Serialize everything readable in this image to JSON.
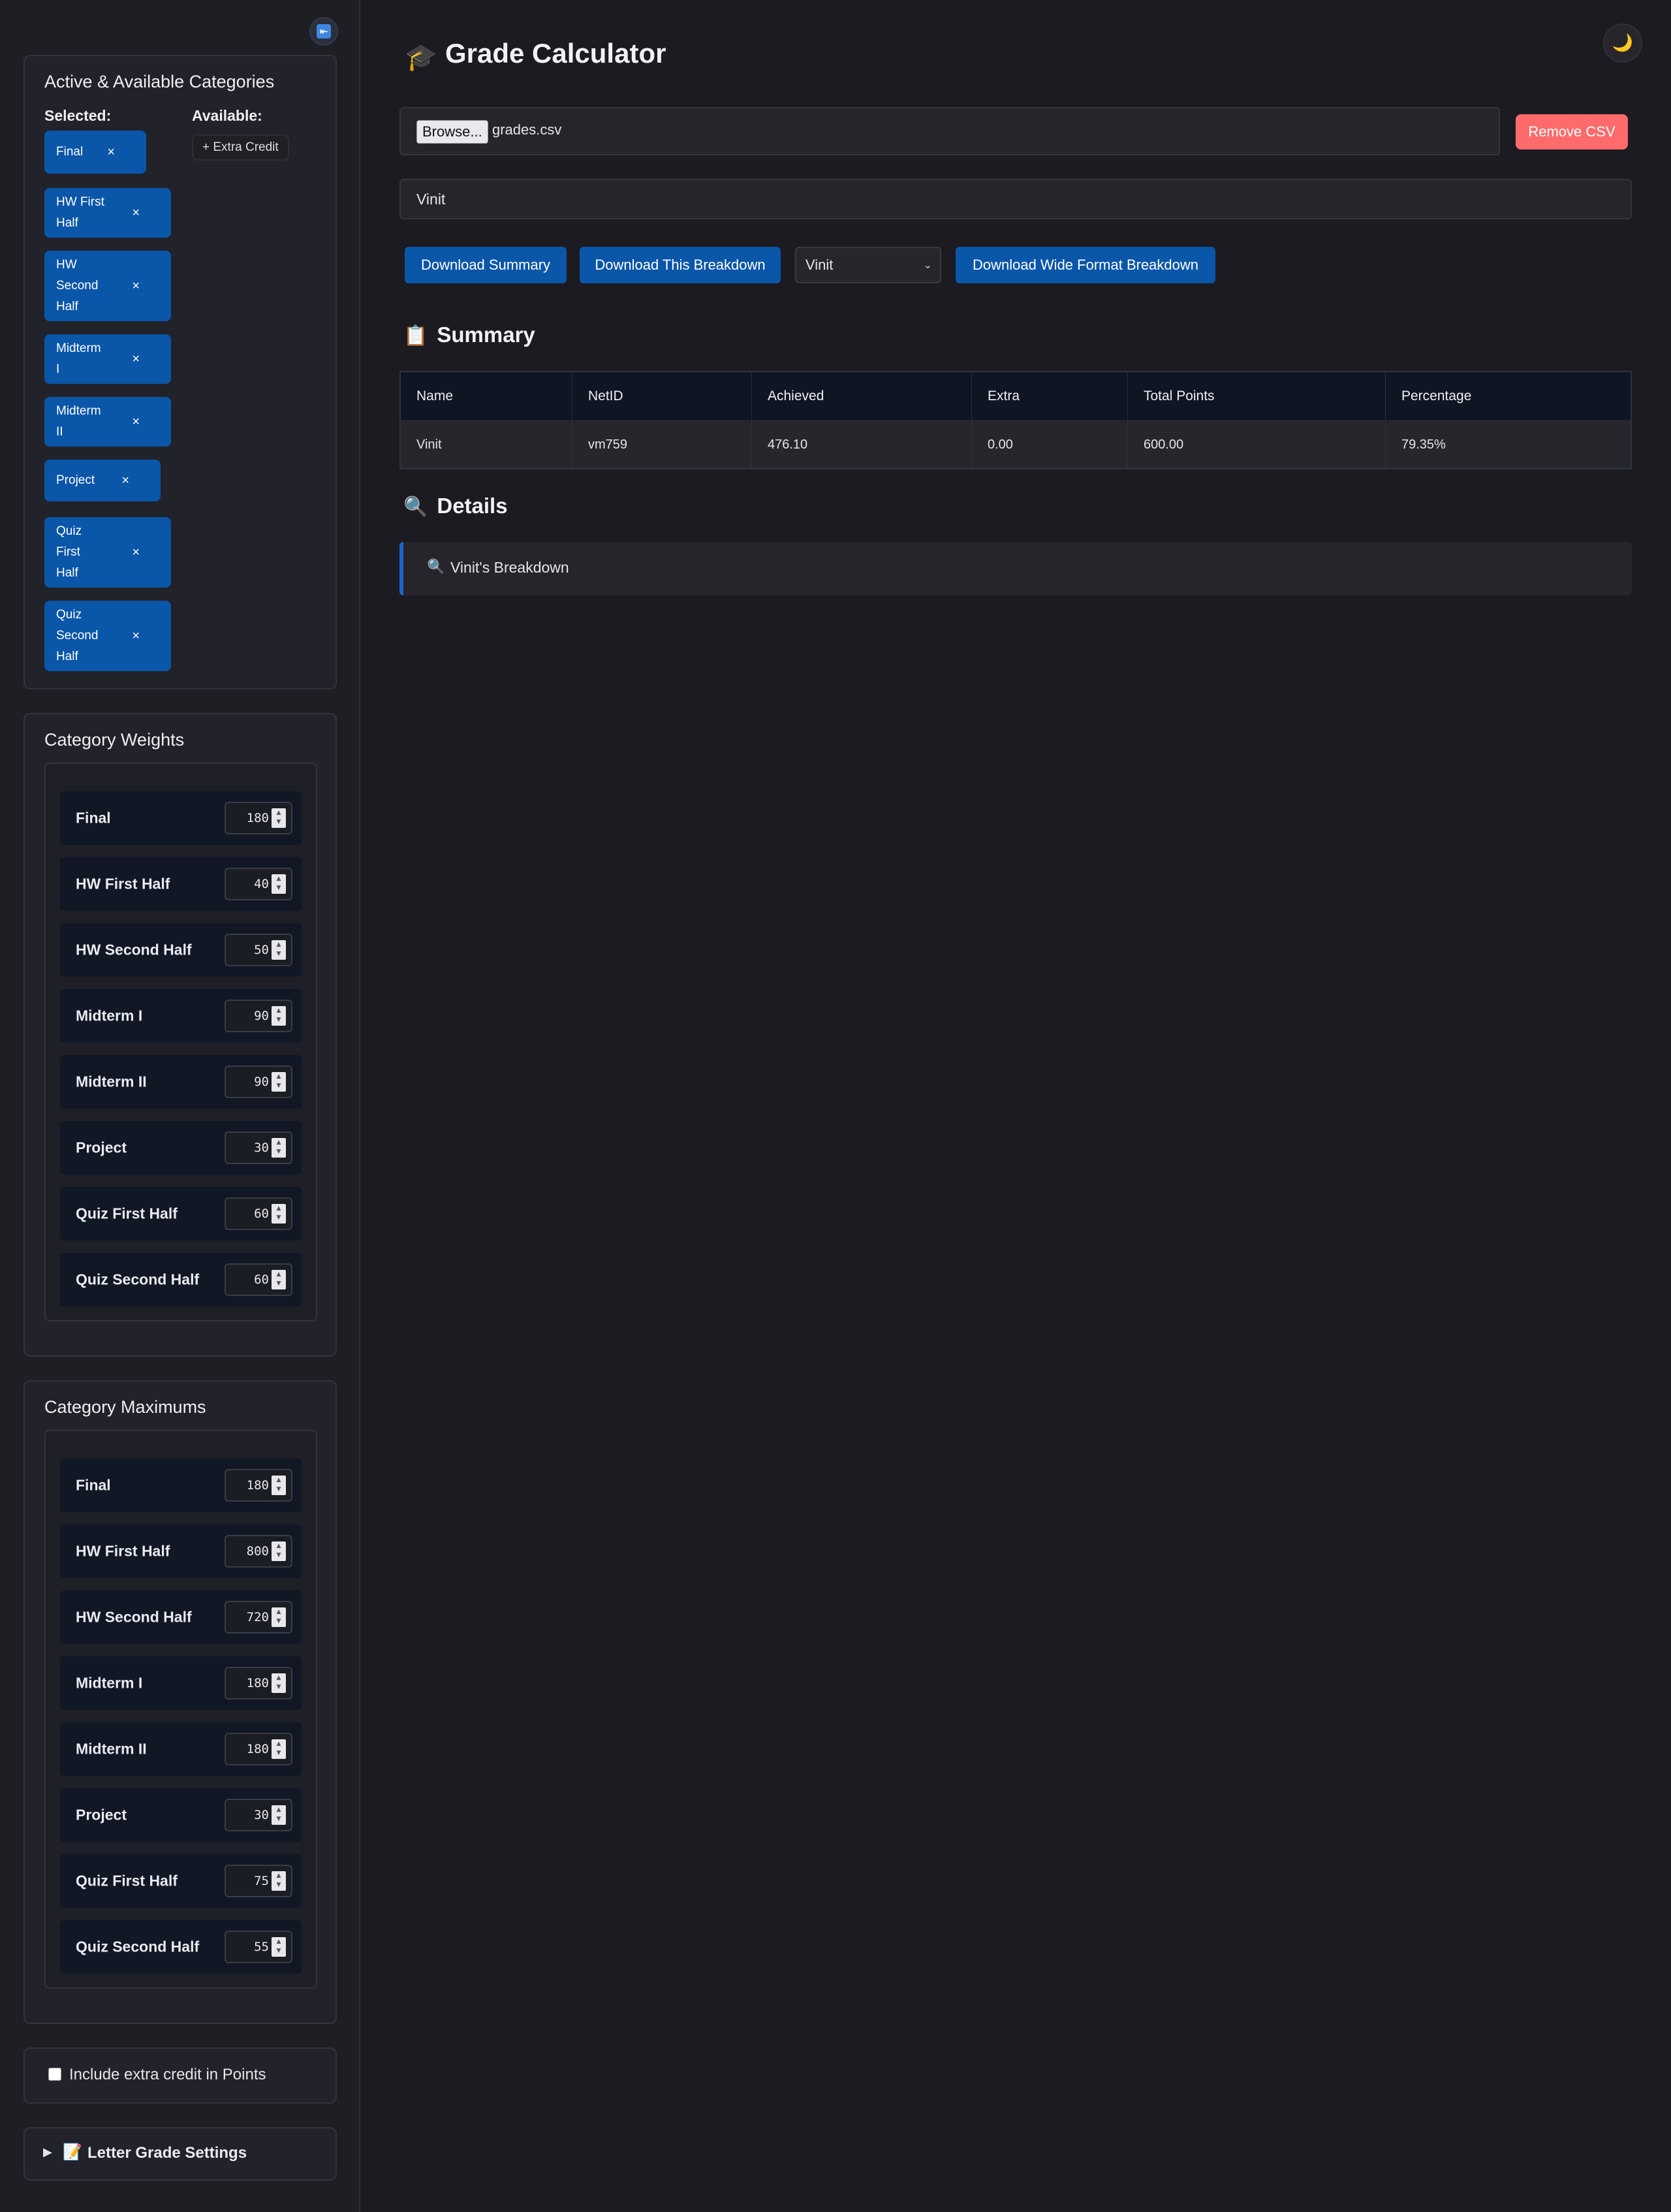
{
  "sidebar": {
    "categories": {
      "title": "Active & Available Categories",
      "selected_label": "Selected:",
      "available_label": "Available:",
      "remove_glyph": "×",
      "selected": [
        {
          "lines": [
            "Final"
          ]
        },
        {
          "lines": [
            "HW First",
            "Half"
          ]
        },
        {
          "lines": [
            "HW",
            "Second",
            "Half"
          ]
        },
        {
          "lines": [
            "Midterm",
            "I"
          ]
        },
        {
          "lines": [
            "Midterm",
            "II"
          ]
        },
        {
          "lines": [
            "Project"
          ]
        },
        {
          "lines": [
            "Quiz",
            "First",
            "Half"
          ]
        },
        {
          "lines": [
            "Quiz",
            "Second",
            "Half"
          ]
        }
      ],
      "available": [
        "+ Extra Credit"
      ]
    },
    "weights": {
      "title": "Category Weights",
      "rows": [
        {
          "label": "Final",
          "value": "180"
        },
        {
          "label": "HW First Half",
          "value": "40"
        },
        {
          "label": "HW Second Half",
          "value": "50"
        },
        {
          "label": "Midterm I",
          "value": "90"
        },
        {
          "label": "Midterm II",
          "value": "90"
        },
        {
          "label": "Project",
          "value": "30"
        },
        {
          "label": "Quiz First Half",
          "value": "60"
        },
        {
          "label": "Quiz Second Half",
          "value": "60"
        }
      ]
    },
    "maximums": {
      "title": "Category Maximums",
      "rows": [
        {
          "label": "Final",
          "value": "180"
        },
        {
          "label": "HW First Half",
          "value": "800"
        },
        {
          "label": "HW Second Half",
          "value": "720"
        },
        {
          "label": "Midterm I",
          "value": "180"
        },
        {
          "label": "Midterm II",
          "value": "180"
        },
        {
          "label": "Project",
          "value": "30"
        },
        {
          "label": "Quiz First Half",
          "value": "75"
        },
        {
          "label": "Quiz Second Half",
          "value": "55"
        }
      ]
    },
    "extra_credit_checkbox": {
      "label": "Include extra credit in Points",
      "checked": false
    },
    "letter_grade": {
      "label": "Letter Grade Settings",
      "icon": "memo-icon"
    }
  },
  "header": {
    "title": "Grade Calculator",
    "icon": "graduation-cap-icon",
    "theme_icon": "moon-icon"
  },
  "file": {
    "browse_label": "Browse...",
    "file_name": "grades.csv",
    "remove_label": "Remove CSV"
  },
  "student_input": {
    "value": "Vinit"
  },
  "actions": {
    "download_summary": "Download Summary",
    "download_breakdown": "Download This Breakdown",
    "student_select": "Vinit",
    "download_wide": "Download Wide Format Breakdown"
  },
  "summary": {
    "title": "Summary",
    "icon": "clipboard-icon",
    "columns": [
      "Name",
      "NetID",
      "Achieved",
      "Extra",
      "Total Points",
      "Percentage"
    ],
    "rows": [
      [
        "Vinit",
        "vm759",
        "476.10",
        "0.00",
        "600.00",
        "79.35%"
      ]
    ]
  },
  "details": {
    "title": "Details",
    "icon": "magnifier-icon",
    "breakdown_label": "Vinit's Breakdown"
  },
  "colors": {
    "accent": "#0a56a8",
    "danger": "#ff6b6b",
    "background": "#1b1b21"
  }
}
